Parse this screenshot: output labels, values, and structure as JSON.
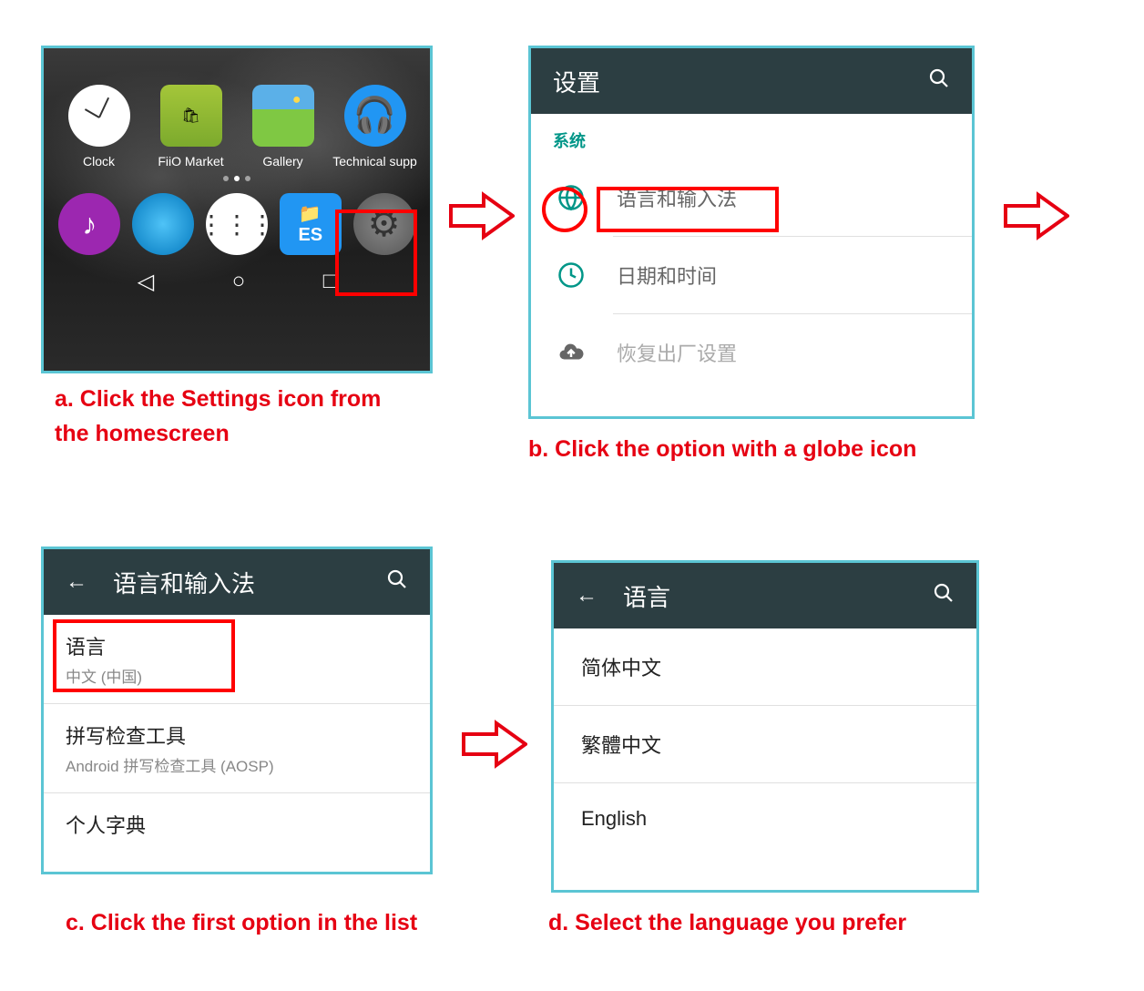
{
  "captions": {
    "a": "a. Click the Settings icon from the homescreen",
    "b": "b. Click the option with a globe icon",
    "c": "c. Click the first option in the list",
    "d": "d. Select the language you prefer"
  },
  "homescreen": {
    "apps_row1": [
      {
        "label": "Clock"
      },
      {
        "label": "FiiO Market"
      },
      {
        "label": "Gallery"
      },
      {
        "label": "Technical supp"
      }
    ]
  },
  "settings": {
    "title": "设置",
    "section": "系统",
    "rows": [
      {
        "label": "语言和输入法"
      },
      {
        "label": "日期和时间"
      },
      {
        "label": "恢复出厂设置"
      }
    ]
  },
  "lang_input": {
    "title": "语言和输入法",
    "rows": [
      {
        "primary": "语言",
        "secondary": "中文 (中国)"
      },
      {
        "primary": "拼写检查工具",
        "secondary": "Android 拼写检查工具 (AOSP)"
      },
      {
        "primary": "个人字典",
        "secondary": ""
      }
    ]
  },
  "language_picker": {
    "title": "语言",
    "options": [
      "简体中文",
      "繁體中文",
      "English"
    ]
  }
}
